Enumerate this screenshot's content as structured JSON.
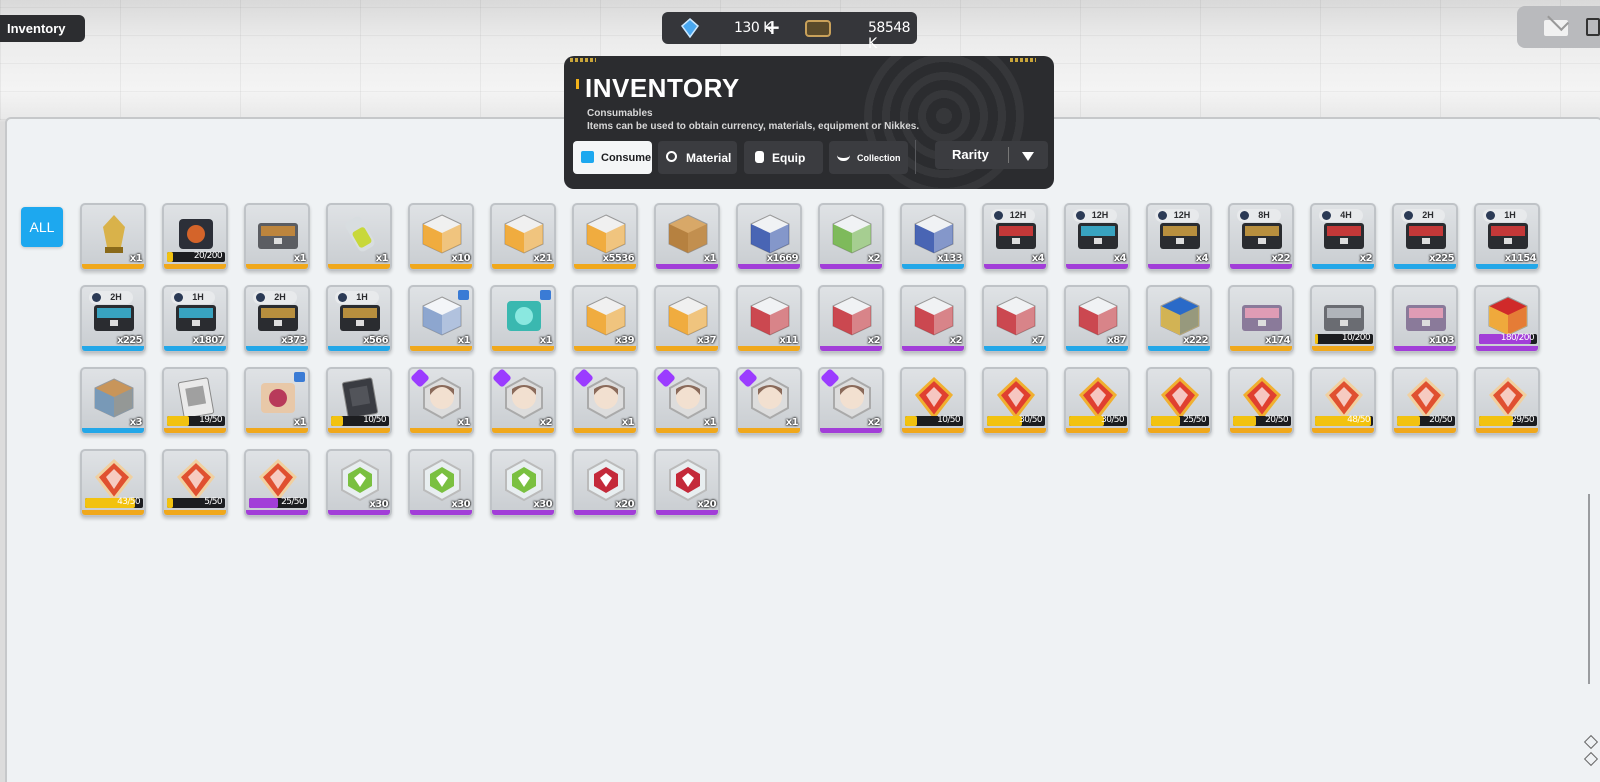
{
  "top_label": "Inventory",
  "currency": {
    "gems": "130 K",
    "plus": "+",
    "credits": "58548 K"
  },
  "header": {
    "title": "INVENTORY",
    "subtitle": "Consumables",
    "description": "Items can be used to obtain currency, materials, equipment or Nikkes.",
    "tabs": [
      {
        "label": "Consume",
        "active": true
      },
      {
        "label": "Material",
        "active": false
      },
      {
        "label": "Equip",
        "active": false
      },
      {
        "label": "Collection",
        "active": false
      }
    ],
    "sort_label": "Rarity"
  },
  "filter_all": "ALL",
  "colors": {
    "gold": "#f0a81c",
    "purple": "#a23ed8",
    "blue": "#23a7e8",
    "accent": "#1da8ef"
  },
  "items": [
    {
      "icon": "trophy-icon",
      "rarity": "gold",
      "count": "x1"
    },
    {
      "icon": "dark-crate-icon",
      "rarity": "gold",
      "progress": "20/200",
      "pct": 0.1
    },
    {
      "icon": "ammo-case-icon",
      "rarity": "gold",
      "count": "x1"
    },
    {
      "icon": "battery-icon",
      "rarity": "gold",
      "count": "x1"
    },
    {
      "icon": "orange-box-icon",
      "rarity": "gold",
      "count": "x10"
    },
    {
      "icon": "orange-box-icon",
      "rarity": "gold",
      "count": "x21"
    },
    {
      "icon": "orange-box-icon",
      "rarity": "gold",
      "count": "x5536"
    },
    {
      "icon": "cardboard-box-icon",
      "rarity": "purple",
      "count": "x1"
    },
    {
      "icon": "blue-box-icon",
      "rarity": "purple",
      "count": "x1669"
    },
    {
      "icon": "green-box-icon",
      "rarity": "purple",
      "count": "x2"
    },
    {
      "icon": "blue-box-icon",
      "rarity": "blue",
      "count": "x133"
    },
    {
      "icon": "red-case-icon",
      "rarity": "purple",
      "count": "x4",
      "timer": "12H"
    },
    {
      "icon": "blue-case-icon",
      "rarity": "purple",
      "count": "x4",
      "timer": "12H"
    },
    {
      "icon": "gold-case-icon",
      "rarity": "purple",
      "count": "x4",
      "timer": "12H"
    },
    {
      "icon": "gold-case-icon",
      "rarity": "purple",
      "count": "x22",
      "timer": "8H"
    },
    {
      "icon": "red-case-icon",
      "rarity": "blue",
      "count": "x2",
      "timer": "4H"
    },
    {
      "icon": "red-case-icon",
      "rarity": "blue",
      "count": "x225",
      "timer": "2H"
    },
    {
      "icon": "red-case-icon",
      "rarity": "blue",
      "count": "x1154",
      "timer": "1H"
    },
    {
      "icon": "blue-case-icon",
      "rarity": "blue",
      "count": "x225",
      "timer": "2H"
    },
    {
      "icon": "blue-case-icon",
      "rarity": "blue",
      "count": "x1807",
      "timer": "1H"
    },
    {
      "icon": "gold-case-icon",
      "rarity": "blue",
      "count": "x373",
      "timer": "2H"
    },
    {
      "icon": "gold-case-icon",
      "rarity": "blue",
      "count": "x566",
      "timer": "1H"
    },
    {
      "icon": "gift-box-icon",
      "rarity": "gold",
      "count": "x1",
      "locked": true
    },
    {
      "icon": "teal-chest-icon",
      "rarity": "gold",
      "count": "x1",
      "locked": true
    },
    {
      "icon": "orange-box-icon",
      "rarity": "gold",
      "count": "x39"
    },
    {
      "icon": "orange-box-icon",
      "rarity": "gold",
      "count": "x37"
    },
    {
      "icon": "red-box-icon",
      "rarity": "gold",
      "count": "x11"
    },
    {
      "icon": "red-box-icon",
      "rarity": "purple",
      "count": "x2"
    },
    {
      "icon": "red-box-icon",
      "rarity": "purple",
      "count": "x2"
    },
    {
      "icon": "red-box-icon",
      "rarity": "blue",
      "count": "x7"
    },
    {
      "icon": "red-box-icon",
      "rarity": "blue",
      "count": "x87"
    },
    {
      "icon": "toolbox-icon",
      "rarity": "blue",
      "count": "x222"
    },
    {
      "icon": "sticker-case-icon",
      "rarity": "gold",
      "count": "x174"
    },
    {
      "icon": "grey-case-icon",
      "rarity": "gold",
      "progress": "10/200",
      "pct": 0.05
    },
    {
      "icon": "sticker-case-icon",
      "rarity": "purple",
      "count": "x103"
    },
    {
      "icon": "red-lucky-box-icon",
      "rarity": "purple",
      "progress": "180/200",
      "pct": 0.9
    },
    {
      "icon": "parcel-icon",
      "rarity": "blue",
      "count": "x3"
    },
    {
      "icon": "poster-icon",
      "rarity": "gold",
      "progress": "19/50",
      "pct": 0.38
    },
    {
      "icon": "character-bundle-icon",
      "rarity": "gold",
      "count": "x1",
      "locked": true
    },
    {
      "icon": "dark-card-icon",
      "rarity": "gold",
      "progress": "10/50",
      "pct": 0.2
    },
    {
      "icon": "nikke-portrait-icon",
      "rarity": "gold",
      "count": "x1",
      "badge": true
    },
    {
      "icon": "nikke-portrait-icon",
      "rarity": "gold",
      "count": "x2",
      "badge": true
    },
    {
      "icon": "nikke-portrait-icon",
      "rarity": "gold",
      "count": "x1",
      "badge": true
    },
    {
      "icon": "nikke-portrait-icon",
      "rarity": "gold",
      "count": "x1",
      "badge": true
    },
    {
      "icon": "nikke-portrait-icon",
      "rarity": "gold",
      "count": "x1",
      "badge": true
    },
    {
      "icon": "nikke-portrait-icon",
      "rarity": "purple",
      "count": "x2",
      "badge": true
    },
    {
      "icon": "ssr-crystal-icon",
      "rarity": "gold",
      "progress": "10/50",
      "pct": 0.2
    },
    {
      "icon": "ssr-crystal-icon",
      "rarity": "gold",
      "progress": "30/50",
      "pct": 0.6
    },
    {
      "icon": "ssr-crystal-icon",
      "rarity": "gold",
      "progress": "30/50",
      "pct": 0.6
    },
    {
      "icon": "ssr-crystal-icon",
      "rarity": "gold",
      "progress": "25/50",
      "pct": 0.5
    },
    {
      "icon": "ssr-crystal-icon",
      "rarity": "gold",
      "progress": "20/50",
      "pct": 0.4
    },
    {
      "icon": "crystal-icon",
      "rarity": "gold",
      "progress": "48/50",
      "pct": 0.96
    },
    {
      "icon": "crystal-icon",
      "rarity": "gold",
      "progress": "20/50",
      "pct": 0.4
    },
    {
      "icon": "crystal-icon",
      "rarity": "gold",
      "progress": "29/50",
      "pct": 0.58
    },
    {
      "icon": "crystal-icon",
      "rarity": "gold",
      "progress": "43/50",
      "pct": 0.86
    },
    {
      "icon": "crystal-icon",
      "rarity": "gold",
      "progress": "5/50",
      "pct": 0.1
    },
    {
      "icon": "crystal-icon",
      "rarity": "purple",
      "progress": "25/50",
      "pct": 0.5
    },
    {
      "icon": "green-hex-icon",
      "rarity": "purple",
      "count": "x30"
    },
    {
      "icon": "green-hex-icon",
      "rarity": "purple",
      "count": "x30"
    },
    {
      "icon": "green-hex-icon",
      "rarity": "purple",
      "count": "x30"
    },
    {
      "icon": "red-hex-icon",
      "rarity": "purple",
      "count": "x20"
    },
    {
      "icon": "red-hex-icon",
      "rarity": "purple",
      "count": "x20"
    }
  ]
}
